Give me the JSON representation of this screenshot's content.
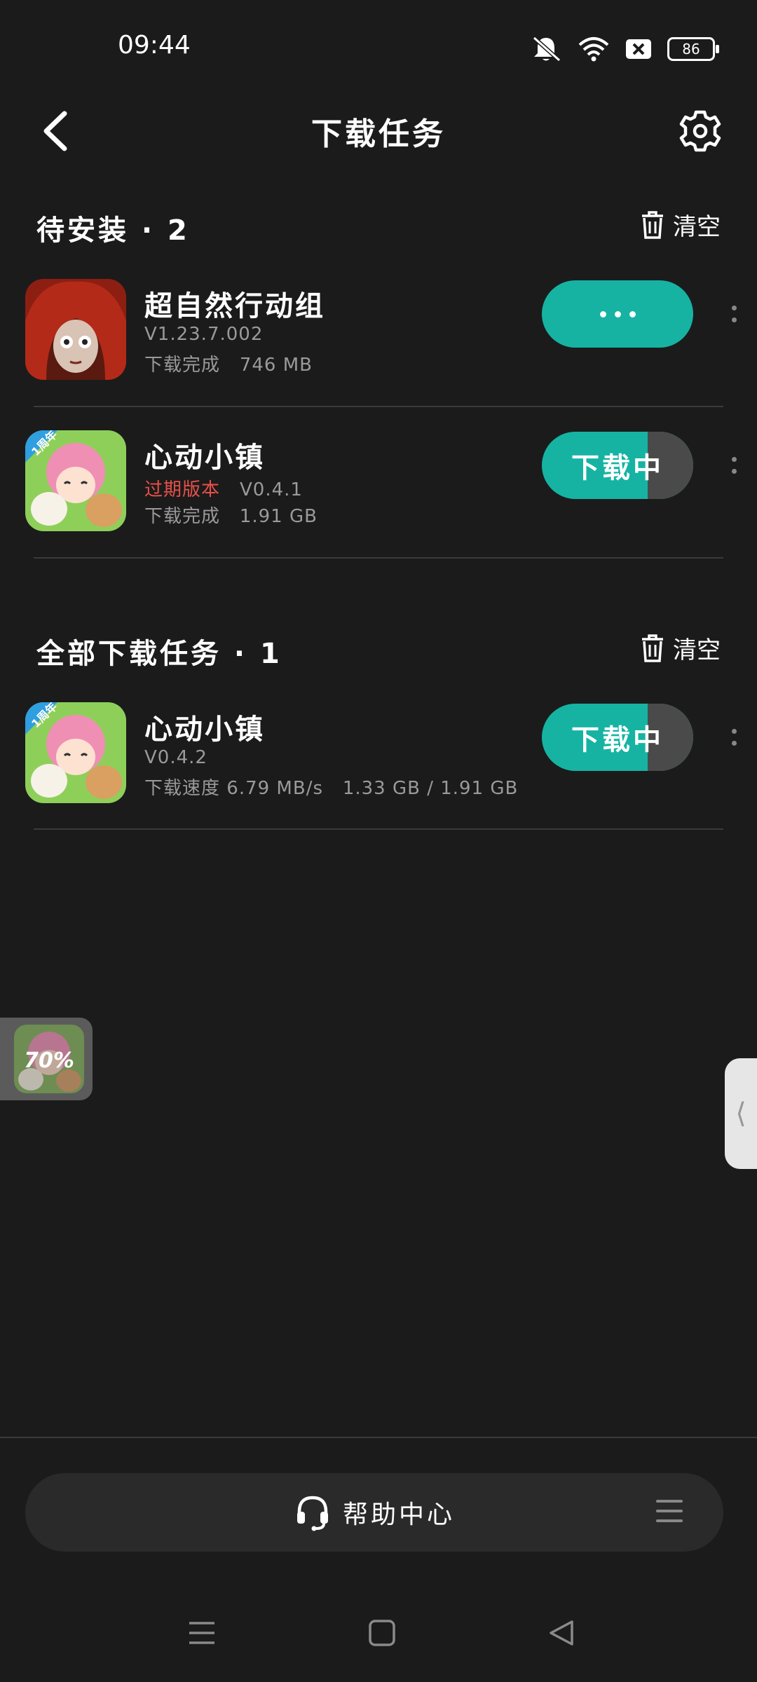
{
  "status_bar": {
    "time": "09:44",
    "battery": "86",
    "icons": [
      "mute-icon",
      "wifi-icon",
      "sim-off-icon",
      "battery-icon"
    ]
  },
  "header": {
    "title": "下载任务",
    "back_icon": "chevron-left-icon",
    "settings_icon": "gear-icon"
  },
  "pending_section": {
    "title": "待安装 · 2",
    "clear_label": "清空",
    "items": [
      {
        "name": "超自然行动组",
        "version": "V1.23.7.002",
        "status": "下载完成",
        "size": "746 MB",
        "button": "···"
      },
      {
        "name": "心动小镇",
        "expired": "过期版本",
        "version": "V0.4.1",
        "status": "下载完成",
        "size": "1.91 GB",
        "button": "下载中",
        "progress": 0.7
      }
    ]
  },
  "all_section": {
    "title": "全部下载任务 · 1",
    "clear_label": "清空",
    "items": [
      {
        "name": "心动小镇",
        "version": "V0.4.2",
        "speed_label": "下载速度",
        "speed": "6.79 MB/s",
        "downloaded": "1.33 GB / 1.91 GB",
        "button": "下载中",
        "progress": 0.7
      }
    ]
  },
  "floating_widget": {
    "percent": "70%"
  },
  "bottom_bar": {
    "help_label": "帮助中心"
  },
  "colors": {
    "accent": "#16b3a3",
    "background": "#1b1b1b",
    "expired": "#e8504a"
  }
}
